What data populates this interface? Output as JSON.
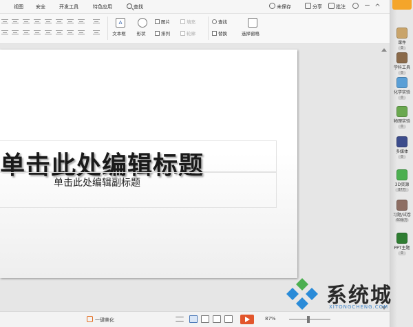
{
  "menu": {
    "tabs": [
      "视图",
      "安全",
      "开发工具",
      "特色应用"
    ],
    "search_label": "查找"
  },
  "top_right": {
    "unsaved": "未保存",
    "share": "分享",
    "annotate": "批注"
  },
  "ribbon": {
    "textbox": "文本框",
    "shape": "形状",
    "picture": "图片",
    "arrange": "排列",
    "fill": "填充",
    "outline": "轮廓",
    "find": "查找",
    "replace": "替换",
    "select_pane": "选择窗格"
  },
  "taskpane": {
    "items": [
      {
        "label": "课件",
        "badge": "0",
        "color": "#c9a46a"
      },
      {
        "label": "学科工具",
        "badge": "0",
        "color": "#8a6a4a"
      },
      {
        "label": "化学实验",
        "badge": "0",
        "color": "#5a9fd6"
      },
      {
        "label": "物理实验",
        "badge": "0",
        "color": "#6aa84f"
      },
      {
        "label": "多媒体",
        "badge": "0",
        "color": "#3c4c8c"
      },
      {
        "label": "3D资源",
        "badge": "87万",
        "color": "#4caf50"
      },
      {
        "label": "习题/试卷",
        "badge": "60余万",
        "color": "#8d6e63"
      },
      {
        "label": "PPT主题",
        "badge": "0",
        "color": "#2f7d32"
      }
    ]
  },
  "slide": {
    "title": "单击此处编辑标题",
    "subtitle": "单击此处编辑副标题"
  },
  "statusbar": {
    "beautify": "一键美化",
    "zoom": "87%"
  },
  "watermark": {
    "text": "系统城",
    "url": "XITONGCHENG.COM"
  }
}
